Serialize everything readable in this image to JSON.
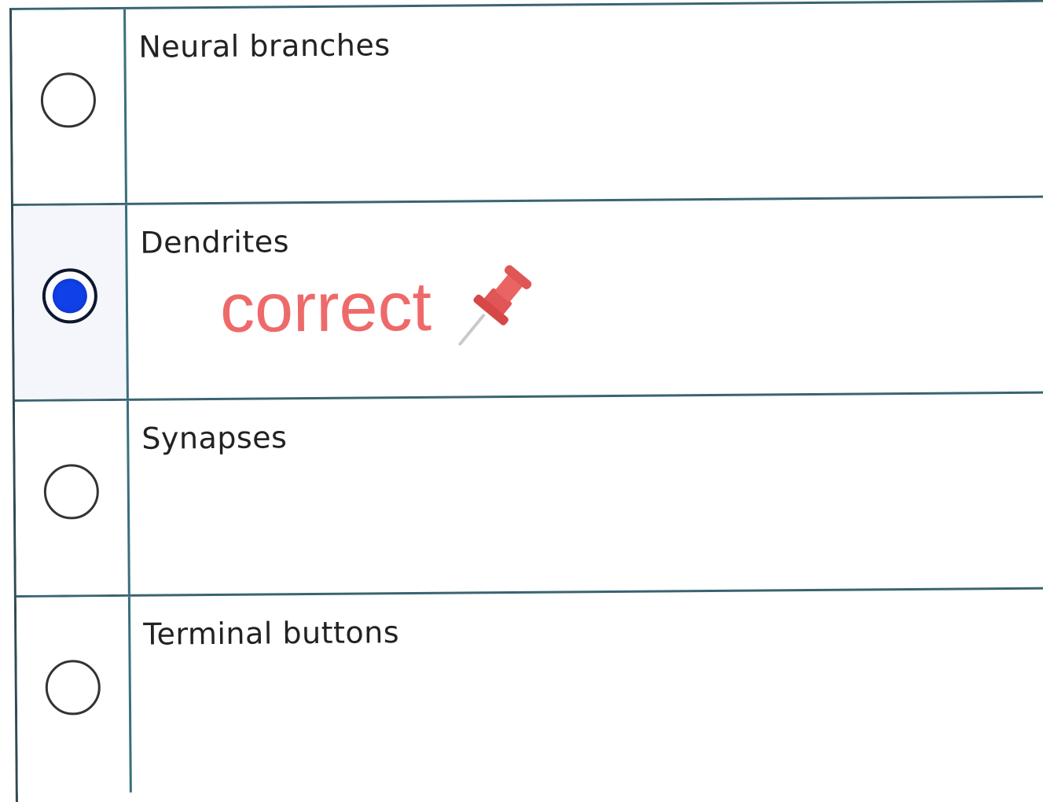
{
  "question": {
    "options": [
      {
        "label": "Neural branches",
        "selected": false
      },
      {
        "label": "Dendrites",
        "selected": true
      },
      {
        "label": "Synapses",
        "selected": false
      },
      {
        "label": "Terminal buttons",
        "selected": false
      }
    ],
    "annotation": {
      "text": "correct",
      "icon": "pushpin-icon",
      "color": "#ee6a6a"
    }
  },
  "colors": {
    "accent": "#1040e8",
    "grid": "#3a6470"
  }
}
